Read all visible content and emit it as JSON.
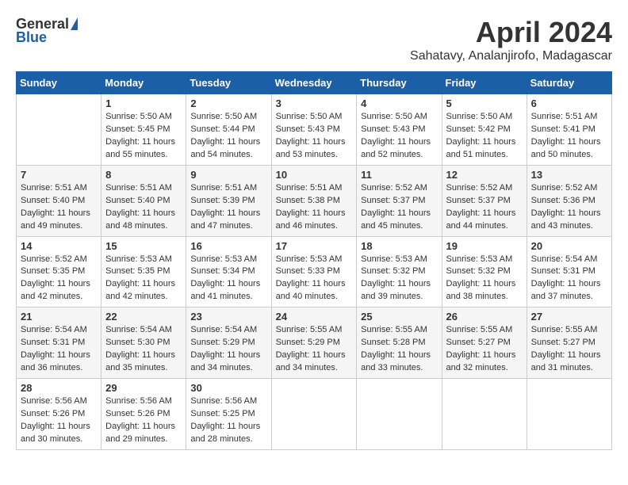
{
  "header": {
    "logo_general": "General",
    "logo_blue": "Blue",
    "title": "April 2024",
    "subtitle": "Sahatavy, Analanjirofo, Madagascar"
  },
  "columns": [
    "Sunday",
    "Monday",
    "Tuesday",
    "Wednesday",
    "Thursday",
    "Friday",
    "Saturday"
  ],
  "weeks": [
    [
      {
        "day": "",
        "sunrise": "",
        "sunset": "",
        "daylight": ""
      },
      {
        "day": "1",
        "sunrise": "Sunrise: 5:50 AM",
        "sunset": "Sunset: 5:45 PM",
        "daylight": "Daylight: 11 hours and 55 minutes."
      },
      {
        "day": "2",
        "sunrise": "Sunrise: 5:50 AM",
        "sunset": "Sunset: 5:44 PM",
        "daylight": "Daylight: 11 hours and 54 minutes."
      },
      {
        "day": "3",
        "sunrise": "Sunrise: 5:50 AM",
        "sunset": "Sunset: 5:43 PM",
        "daylight": "Daylight: 11 hours and 53 minutes."
      },
      {
        "day": "4",
        "sunrise": "Sunrise: 5:50 AM",
        "sunset": "Sunset: 5:43 PM",
        "daylight": "Daylight: 11 hours and 52 minutes."
      },
      {
        "day": "5",
        "sunrise": "Sunrise: 5:50 AM",
        "sunset": "Sunset: 5:42 PM",
        "daylight": "Daylight: 11 hours and 51 minutes."
      },
      {
        "day": "6",
        "sunrise": "Sunrise: 5:51 AM",
        "sunset": "Sunset: 5:41 PM",
        "daylight": "Daylight: 11 hours and 50 minutes."
      }
    ],
    [
      {
        "day": "7",
        "sunrise": "Sunrise: 5:51 AM",
        "sunset": "Sunset: 5:40 PM",
        "daylight": "Daylight: 11 hours and 49 minutes."
      },
      {
        "day": "8",
        "sunrise": "Sunrise: 5:51 AM",
        "sunset": "Sunset: 5:40 PM",
        "daylight": "Daylight: 11 hours and 48 minutes."
      },
      {
        "day": "9",
        "sunrise": "Sunrise: 5:51 AM",
        "sunset": "Sunset: 5:39 PM",
        "daylight": "Daylight: 11 hours and 47 minutes."
      },
      {
        "day": "10",
        "sunrise": "Sunrise: 5:51 AM",
        "sunset": "Sunset: 5:38 PM",
        "daylight": "Daylight: 11 hours and 46 minutes."
      },
      {
        "day": "11",
        "sunrise": "Sunrise: 5:52 AM",
        "sunset": "Sunset: 5:37 PM",
        "daylight": "Daylight: 11 hours and 45 minutes."
      },
      {
        "day": "12",
        "sunrise": "Sunrise: 5:52 AM",
        "sunset": "Sunset: 5:37 PM",
        "daylight": "Daylight: 11 hours and 44 minutes."
      },
      {
        "day": "13",
        "sunrise": "Sunrise: 5:52 AM",
        "sunset": "Sunset: 5:36 PM",
        "daylight": "Daylight: 11 hours and 43 minutes."
      }
    ],
    [
      {
        "day": "14",
        "sunrise": "Sunrise: 5:52 AM",
        "sunset": "Sunset: 5:35 PM",
        "daylight": "Daylight: 11 hours and 42 minutes."
      },
      {
        "day": "15",
        "sunrise": "Sunrise: 5:53 AM",
        "sunset": "Sunset: 5:35 PM",
        "daylight": "Daylight: 11 hours and 42 minutes."
      },
      {
        "day": "16",
        "sunrise": "Sunrise: 5:53 AM",
        "sunset": "Sunset: 5:34 PM",
        "daylight": "Daylight: 11 hours and 41 minutes."
      },
      {
        "day": "17",
        "sunrise": "Sunrise: 5:53 AM",
        "sunset": "Sunset: 5:33 PM",
        "daylight": "Daylight: 11 hours and 40 minutes."
      },
      {
        "day": "18",
        "sunrise": "Sunrise: 5:53 AM",
        "sunset": "Sunset: 5:32 PM",
        "daylight": "Daylight: 11 hours and 39 minutes."
      },
      {
        "day": "19",
        "sunrise": "Sunrise: 5:53 AM",
        "sunset": "Sunset: 5:32 PM",
        "daylight": "Daylight: 11 hours and 38 minutes."
      },
      {
        "day": "20",
        "sunrise": "Sunrise: 5:54 AM",
        "sunset": "Sunset: 5:31 PM",
        "daylight": "Daylight: 11 hours and 37 minutes."
      }
    ],
    [
      {
        "day": "21",
        "sunrise": "Sunrise: 5:54 AM",
        "sunset": "Sunset: 5:31 PM",
        "daylight": "Daylight: 11 hours and 36 minutes."
      },
      {
        "day": "22",
        "sunrise": "Sunrise: 5:54 AM",
        "sunset": "Sunset: 5:30 PM",
        "daylight": "Daylight: 11 hours and 35 minutes."
      },
      {
        "day": "23",
        "sunrise": "Sunrise: 5:54 AM",
        "sunset": "Sunset: 5:29 PM",
        "daylight": "Daylight: 11 hours and 34 minutes."
      },
      {
        "day": "24",
        "sunrise": "Sunrise: 5:55 AM",
        "sunset": "Sunset: 5:29 PM",
        "daylight": "Daylight: 11 hours and 34 minutes."
      },
      {
        "day": "25",
        "sunrise": "Sunrise: 5:55 AM",
        "sunset": "Sunset: 5:28 PM",
        "daylight": "Daylight: 11 hours and 33 minutes."
      },
      {
        "day": "26",
        "sunrise": "Sunrise: 5:55 AM",
        "sunset": "Sunset: 5:27 PM",
        "daylight": "Daylight: 11 hours and 32 minutes."
      },
      {
        "day": "27",
        "sunrise": "Sunrise: 5:55 AM",
        "sunset": "Sunset: 5:27 PM",
        "daylight": "Daylight: 11 hours and 31 minutes."
      }
    ],
    [
      {
        "day": "28",
        "sunrise": "Sunrise: 5:56 AM",
        "sunset": "Sunset: 5:26 PM",
        "daylight": "Daylight: 11 hours and 30 minutes."
      },
      {
        "day": "29",
        "sunrise": "Sunrise: 5:56 AM",
        "sunset": "Sunset: 5:26 PM",
        "daylight": "Daylight: 11 hours and 29 minutes."
      },
      {
        "day": "30",
        "sunrise": "Sunrise: 5:56 AM",
        "sunset": "Sunset: 5:25 PM",
        "daylight": "Daylight: 11 hours and 28 minutes."
      },
      {
        "day": "",
        "sunrise": "",
        "sunset": "",
        "daylight": ""
      },
      {
        "day": "",
        "sunrise": "",
        "sunset": "",
        "daylight": ""
      },
      {
        "day": "",
        "sunrise": "",
        "sunset": "",
        "daylight": ""
      },
      {
        "day": "",
        "sunrise": "",
        "sunset": "",
        "daylight": ""
      }
    ]
  ]
}
